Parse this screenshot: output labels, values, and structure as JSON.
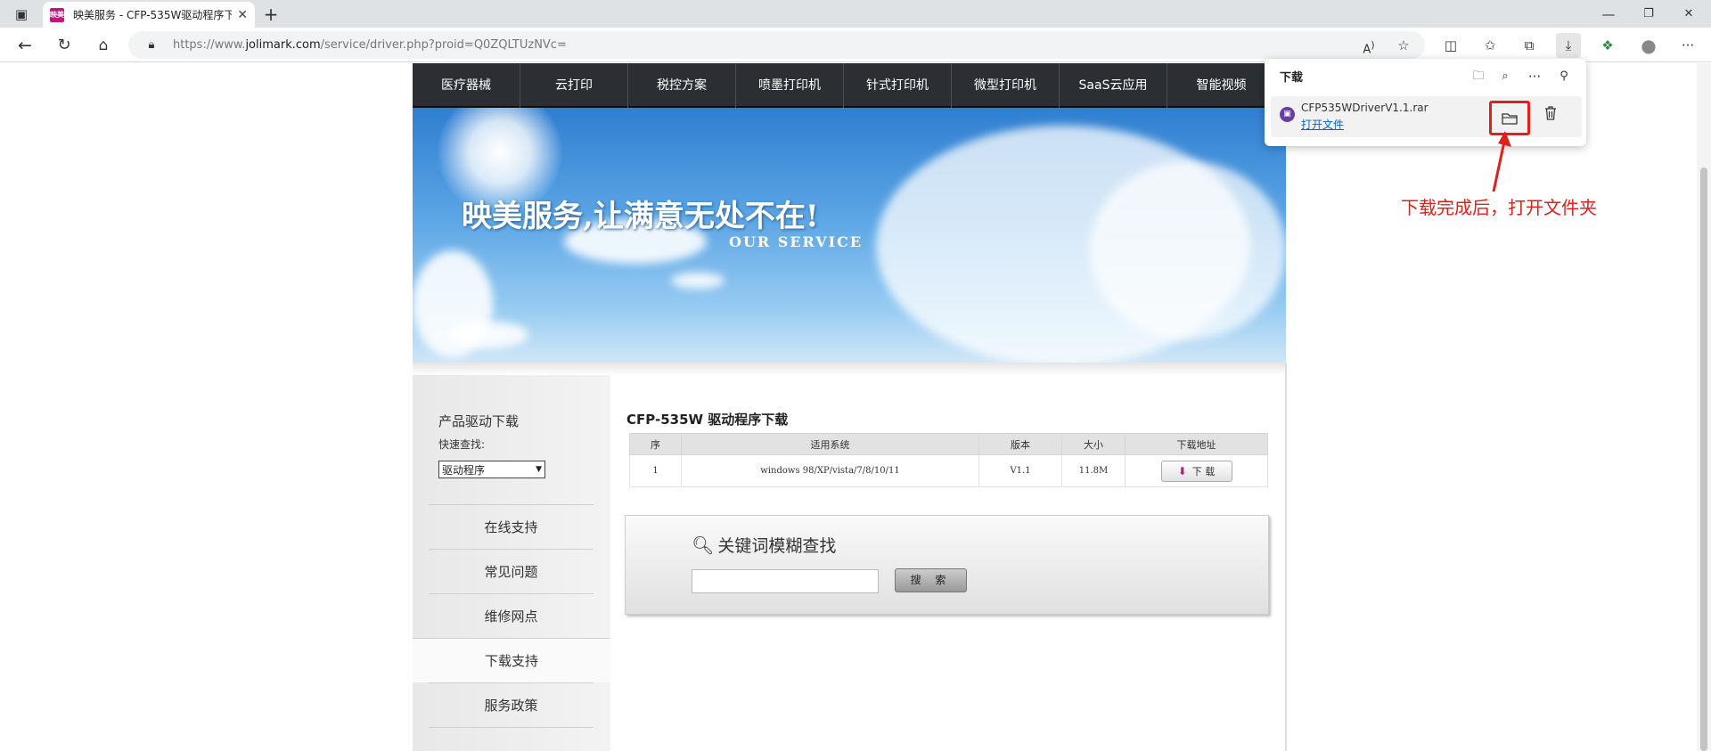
{
  "browser": {
    "tab": {
      "title": "映美服务 - CFP-535W驱动程序下",
      "favicon_text": "映美"
    },
    "url": {
      "prefix": "https://www.",
      "domain": "jolimark.com",
      "path": "/service/driver.php?proid=Q0ZQLTUzNVc="
    },
    "icons": [
      "sidebar-toggle-icon",
      "new-tab-icon",
      "back-icon",
      "reload-icon",
      "home-icon",
      "site-info-icon",
      "read-aloud-icon",
      "favorite-icon",
      "split-screen-icon",
      "favorites-icon",
      "collections-icon",
      "downloads-icon",
      "extensions-icon",
      "profile-icon",
      "more-icon"
    ],
    "window_controls": {
      "minimize": "—",
      "restore": "❐",
      "close": "✕"
    }
  },
  "nav": {
    "items": [
      "医疗器械",
      "云打印",
      "税控方案",
      "喷墨打印机",
      "针式打印机",
      "微型打印机",
      "SaaS云应用",
      "智能视频"
    ]
  },
  "banner": {
    "slogan": "映美服务,让满意无处不在!",
    "subtitle": "OUR SERVICE"
  },
  "sidebar": {
    "title": "产品驱动下载",
    "quick_label": "快速查找:",
    "select_value": "驱动程序",
    "items": [
      "在线支持",
      "常见问题",
      "维修网点",
      "下载支持",
      "服务政策"
    ],
    "active_index": 3
  },
  "driver": {
    "title": "CFP-535W  驱动程序下载",
    "columns": [
      "序",
      "适用系统",
      "版本",
      "大小",
      "下载地址"
    ],
    "rows": [
      {
        "no": "1",
        "system": "windows 98/XP/vista/7/8/10/11",
        "version": "V1.1",
        "size": "11.8M",
        "download_label": "下 载"
      }
    ]
  },
  "search": {
    "title": "关键词模糊查找",
    "button": "搜 索",
    "value": ""
  },
  "downloads_panel": {
    "title": "下载",
    "file_name": "CFP535WDriverV1.1.rar",
    "open_file": "打开文件"
  },
  "annotation": {
    "text": "下载完成后，打开文件夹",
    "color": "#e0201b"
  }
}
